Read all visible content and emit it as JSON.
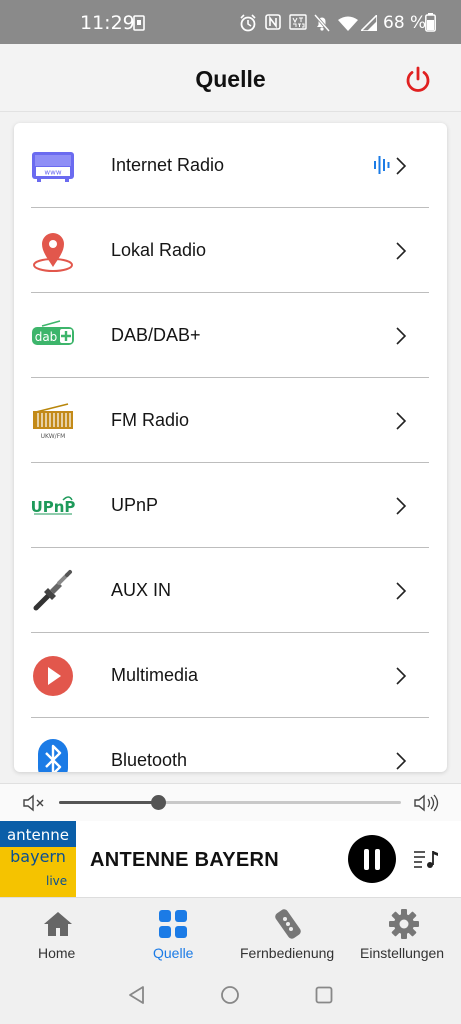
{
  "status_bar": {
    "time": "11:29",
    "battery": "68 %"
  },
  "header": {
    "title": "Quelle",
    "power_icon": "power-icon",
    "power_color": "#e02020"
  },
  "sources": [
    {
      "label": "Internet Radio",
      "icon": "internet-radio-icon",
      "active": true
    },
    {
      "label": "Lokal Radio",
      "icon": "location-pin-icon"
    },
    {
      "label": "DAB/DAB+",
      "icon": "dab-icon"
    },
    {
      "label": "FM Radio",
      "icon": "fm-radio-icon"
    },
    {
      "label": "UPnP",
      "icon": "upnp-icon"
    },
    {
      "label": "AUX IN",
      "icon": "aux-jack-icon"
    },
    {
      "label": "Multimedia",
      "icon": "play-icon"
    },
    {
      "label": "Bluetooth",
      "icon": "bluetooth-icon"
    }
  ],
  "volume": {
    "level": 0.29
  },
  "now_playing": {
    "station": "ANTENNE BAYERN",
    "logo_line1": "antenne",
    "logo_line2": "bayern",
    "logo_line3": "live"
  },
  "nav": {
    "items": [
      {
        "label": "Home",
        "icon": "home-icon"
      },
      {
        "label": "Quelle",
        "icon": "grid-icon",
        "active": true
      },
      {
        "label": "Fernbedienung",
        "icon": "remote-icon"
      },
      {
        "label": "Einstellungen",
        "icon": "gear-icon"
      }
    ],
    "active_color": "#1b7be6"
  },
  "system_nav": [
    "back-icon",
    "home-circle-icon",
    "recents-icon"
  ]
}
